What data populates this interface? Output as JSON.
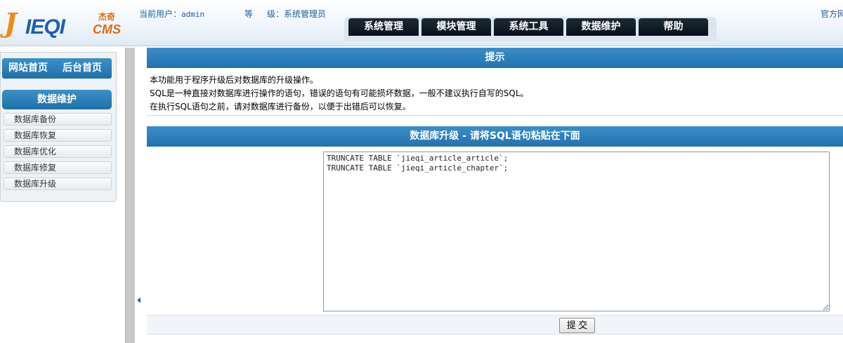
{
  "header": {
    "logo": {
      "mark": "J",
      "brand": "IEQI",
      "cn": "杰奇",
      "cms": "CMS"
    },
    "current_user_label": "当前用户：",
    "current_user": "admin",
    "grade_label": "等",
    "grade_label_2": "级：",
    "grade_value": "系统管理员",
    "official_link": "官方网"
  },
  "nav": [
    {
      "label": "系统管理"
    },
    {
      "label": "模块管理"
    },
    {
      "label": "系统工具"
    },
    {
      "label": "数据维护"
    },
    {
      "label": "帮助"
    }
  ],
  "sidebar": {
    "site_home": "网站首页",
    "admin_home": "后台首页",
    "section_title": "数据维护",
    "items": [
      {
        "label": "数据库备份"
      },
      {
        "label": "数据库恢复"
      },
      {
        "label": "数据库优化"
      },
      {
        "label": "数据库修复"
      },
      {
        "label": "数据库升级"
      }
    ]
  },
  "tips": {
    "title": "提示",
    "lines": [
      "本功能用于程序升级后对数据库的升级操作。",
      "SQL是一种直接对数据库进行操作的语句，错误的语句有可能损坏数据，一般不建议执行自写的SQL。",
      "在执行SQL语句之前，请对数据库进行备份，以便于出错后可以恢复。"
    ]
  },
  "upgrade": {
    "title": "数据库升级 - 请将SQL语句粘贴在下面",
    "sql": "TRUNCATE TABLE `jieqi_article_article`;\nTRUNCATE TABLE `jieqi_article_chapter`;",
    "submit_label": "提 交"
  }
}
